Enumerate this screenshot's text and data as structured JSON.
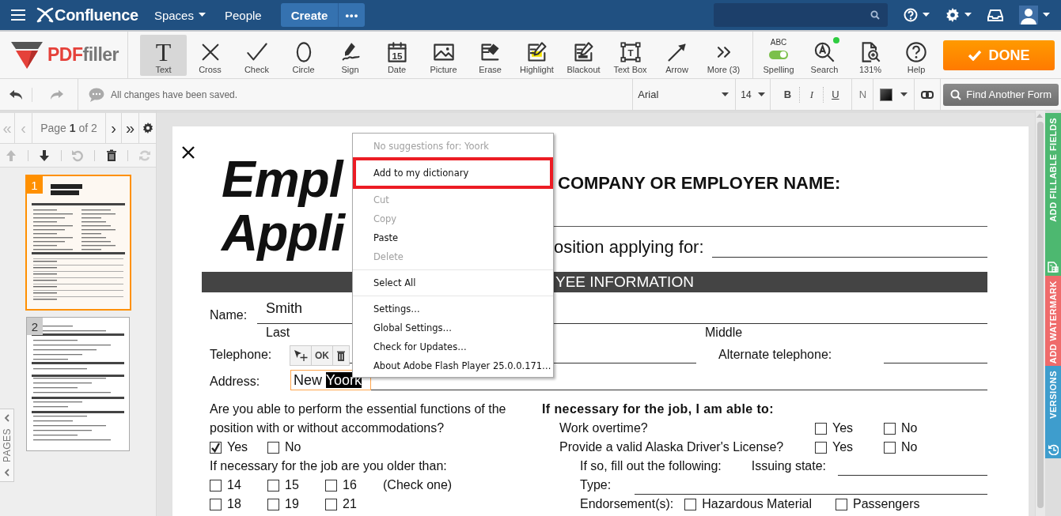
{
  "confluence_bar": {
    "logo": "Confluence",
    "nav": [
      {
        "label": "Spaces",
        "dropdown": true
      },
      {
        "label": "People",
        "dropdown": false
      }
    ],
    "create_button": "Create",
    "more_button": "•••"
  },
  "toolbar": {
    "logo": {
      "part_1": "PDF",
      "part_2": "filler"
    },
    "tools": [
      {
        "label": "Text",
        "kind": "text",
        "glyph": "T",
        "selected": true
      },
      {
        "label": "Cross",
        "kind": "cross",
        "selected": false
      },
      {
        "label": "Check",
        "kind": "check",
        "selected": false
      },
      {
        "label": "Circle",
        "kind": "circle",
        "selected": false
      },
      {
        "label": "Sign",
        "kind": "sign",
        "selected": false
      },
      {
        "label": "Date",
        "kind": "date",
        "glyph": "15",
        "selected": false
      },
      {
        "label": "Picture",
        "kind": "picture",
        "selected": false
      },
      {
        "label": "Erase",
        "kind": "erase",
        "selected": false
      },
      {
        "label": "Highlight",
        "kind": "highlight",
        "selected": false
      },
      {
        "label": "Blackout",
        "kind": "blackout",
        "selected": false
      },
      {
        "label": "Text Box",
        "kind": "textbox",
        "glyph": "T",
        "selected": false
      },
      {
        "label": "Arrow",
        "kind": "arrow",
        "selected": false
      },
      {
        "label": "More (3)",
        "kind": "more",
        "selected": false
      }
    ],
    "actions": [
      {
        "kind": "spelling",
        "caption": "ABC",
        "label": "Spelling",
        "on": true
      },
      {
        "kind": "search",
        "label": "Search",
        "notification": true
      },
      {
        "kind": "zoom",
        "label": "131%"
      },
      {
        "kind": "help",
        "label": "Help"
      }
    ],
    "done_button": "DONE"
  },
  "format_bar": {
    "status": "All changes have been saved.",
    "font": "Arial",
    "size": "14",
    "styles": [
      {
        "label": "B",
        "kind": "bold"
      },
      {
        "label": "I",
        "kind": "italic"
      },
      {
        "label": "U",
        "kind": "underline"
      },
      {
        "label": "N",
        "kind": "normal"
      }
    ],
    "find_button": "Find Another Form"
  },
  "pages_panel": {
    "first": "«",
    "prev": "‹",
    "page_label": "Page **1** of 2",
    "next": "›",
    "last": "»",
    "thumbnails": [
      {
        "number": "1",
        "selected": true
      },
      {
        "number": "2",
        "selected": false
      }
    ],
    "tab": "PAGES"
  },
  "document": {
    "title_lines": [
      "Empl",
      "Appli"
    ],
    "company_label": "COMPANY OR EMPLOYER NAME:",
    "position_label": "osition applying for:",
    "section_band": "YEE INFORMATION",
    "name": {
      "label": "Name:",
      "value": "Smith",
      "captions": [
        "Last",
        "Middle"
      ]
    },
    "telephone": {
      "label": "Telephone:",
      "alternate_label": "Alternate telephone:"
    },
    "address": {
      "label": "Address:",
      "value": "New ",
      "selected_text": "Yoork"
    },
    "mini_toolbar": {
      "ok": "OK"
    },
    "essential_question": "Are you able to perform the essential functions of the position with or without accommodations?",
    "essential_options": [
      {
        "label": "Yes",
        "checked": true
      },
      {
        "label": "No",
        "checked": false
      }
    ],
    "age_question": "If necessary for the job are you older than:",
    "age_options": [
      {
        "label": "14",
        "checked": false
      },
      {
        "label": "15",
        "checked": false
      },
      {
        "label": "16",
        "checked": false
      },
      {
        "label": "18",
        "checked": false
      },
      {
        "label": "19",
        "checked": false
      },
      {
        "label": "21",
        "checked": false
      }
    ],
    "age_note": "(Check one)",
    "abilities_heading": "If necessary for the job, I am able to:",
    "abilities": [
      {
        "question": "Work overtime?",
        "options": [
          {
            "label": "Yes",
            "checked": false
          },
          {
            "label": "No",
            "checked": false
          }
        ]
      },
      {
        "question": "Provide a valid Alaska Driver's License?",
        "options": [
          {
            "label": "Yes",
            "checked": false
          },
          {
            "label": "No",
            "checked": false
          }
        ]
      }
    ],
    "license_hint": "If so, fill out the following:",
    "issuing_state_label": "Issuing state:",
    "type_label": "Type:",
    "endorsement_label": "Endorsement(s):",
    "endorsements": [
      {
        "label": "Hazardous Material",
        "checked": false
      },
      {
        "label": "Passengers",
        "checked": false
      }
    ]
  },
  "context_menu": {
    "groups": [
      [
        {
          "label": "No suggestions for: Yoork",
          "disabled": true,
          "highlighted": false
        }
      ],
      [
        {
          "label": "Add to my dictionary",
          "disabled": false,
          "highlighted": true
        }
      ],
      [
        {
          "label": "Cut",
          "disabled": true,
          "highlighted": false
        },
        {
          "label": "Copy",
          "disabled": true,
          "highlighted": false
        },
        {
          "label": "Paste",
          "disabled": false,
          "highlighted": false
        },
        {
          "label": "Delete",
          "disabled": true,
          "highlighted": false
        }
      ],
      [
        {
          "label": "Select All",
          "disabled": false,
          "highlighted": false
        }
      ],
      [
        {
          "label": "Settings…",
          "disabled": false,
          "highlighted": false
        },
        {
          "label": "Global Settings…",
          "disabled": false,
          "highlighted": false
        },
        {
          "label": "Check for Updates…",
          "disabled": false,
          "highlighted": false
        },
        {
          "label": "About Adobe Flash Player 25.0.0.171…",
          "disabled": false,
          "highlighted": false
        }
      ]
    ]
  },
  "side_tabs": [
    {
      "label": "ADD FILLABLE FIELDS",
      "kind": "fields",
      "color": "#4db870"
    },
    {
      "label": "ADD WATERMARK",
      "kind": "watermark",
      "color": "#ef6b6b"
    },
    {
      "label": "VERSIONS",
      "kind": "versions",
      "color": "#3e9dcd"
    }
  ]
}
